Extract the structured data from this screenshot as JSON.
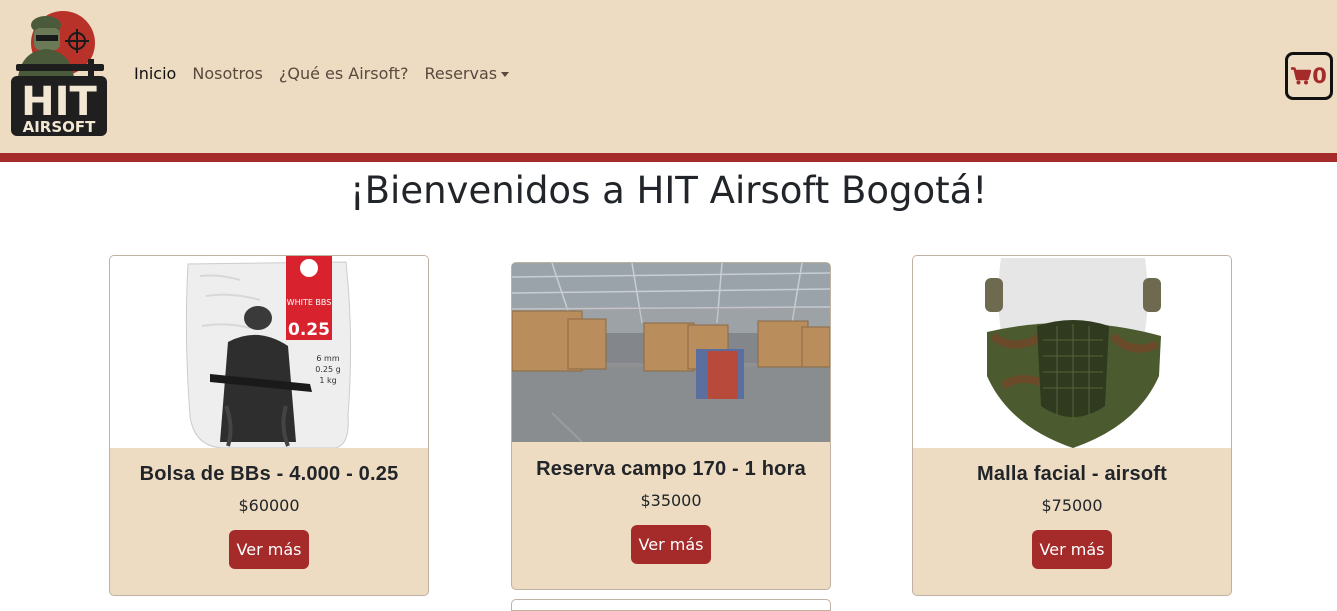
{
  "nav": {
    "logo_text_top": "HIT",
    "logo_text_bottom": "AIRSOFT",
    "links": [
      {
        "label": "Inicio"
      },
      {
        "label": "Nosotros"
      },
      {
        "label": "¿Qué es Airsoft?"
      },
      {
        "label": "Reservas"
      }
    ],
    "cart_count": "0"
  },
  "main": {
    "heading": "¡Bienvenidos a HIT Airsoft Bogotá!"
  },
  "products": [
    {
      "title": "Bolsa de BBs - 4.000 - 0.25",
      "price": "$60000",
      "button": "Ver más",
      "bag_label_brand": "WHITE BBS",
      "bag_label_weight": "0.25",
      "bag_spec_1": "6 mm",
      "bag_spec_2": "0.25 g",
      "bag_spec_3": "1 kg"
    },
    {
      "title": "Reserva campo 170 - 1 hora",
      "price": "$35000",
      "button": "Ver más"
    },
    {
      "title": "Malla facial - airsoft",
      "price": "$75000",
      "button": "Ver más"
    }
  ],
  "colors": {
    "accent": "#a52a2a",
    "nav_bg": "#eddbc2",
    "card_bg": "#eddbc2"
  }
}
